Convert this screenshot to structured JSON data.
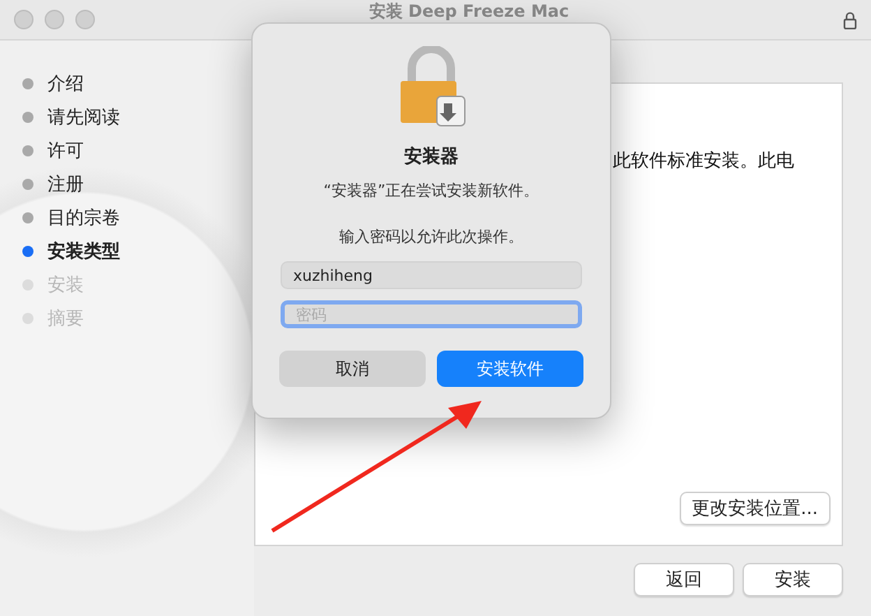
{
  "window": {
    "title": "安装 Deep Freeze Mac"
  },
  "steps": [
    {
      "label": "介绍",
      "selected": false,
      "disabled": false
    },
    {
      "label": "请先阅读",
      "selected": false,
      "disabled": false
    },
    {
      "label": "许可",
      "selected": false,
      "disabled": false
    },
    {
      "label": "注册",
      "selected": false,
      "disabled": false
    },
    {
      "label": "目的宗卷",
      "selected": false,
      "disabled": false
    },
    {
      "label": "安装类型",
      "selected": true,
      "disabled": false
    },
    {
      "label": "安装",
      "selected": false,
      "disabled": true
    },
    {
      "label": "摘要",
      "selected": false,
      "disabled": true
    }
  ],
  "content": {
    "text": "此软件标准安装。此电",
    "change_location_button": "更改安装位置..."
  },
  "footer_buttons": [
    "返回",
    "安装"
  ],
  "dialog": {
    "title": "安装器",
    "message": "“安装器”正在尝试安装新软件。",
    "prompt": "输入密码以允许此次操作。",
    "username": {
      "value": "xuzhiheng",
      "focused": false
    },
    "password": {
      "placeholder": "密码",
      "focused": true
    },
    "buttons": [
      {
        "label": "取消",
        "default": false
      },
      {
        "label": "安装软件",
        "default": true
      }
    ]
  }
}
